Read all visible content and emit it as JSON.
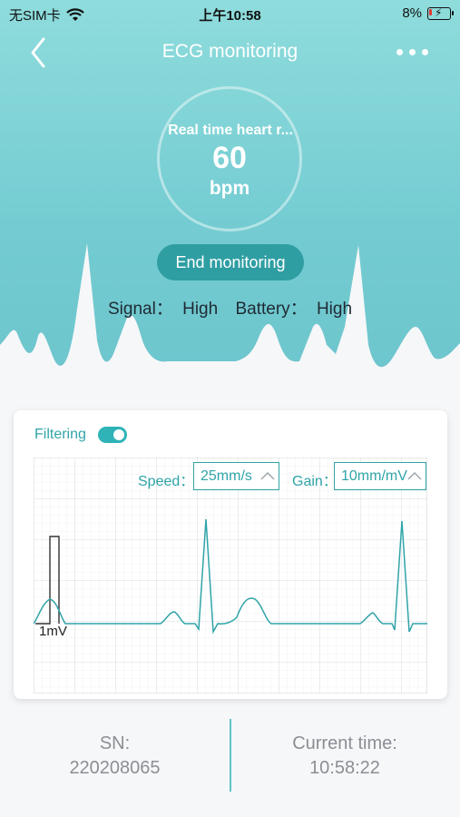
{
  "status_bar": {
    "carrier": "无SIM卡",
    "time": "上午10:58",
    "battery_percent": "8%"
  },
  "nav": {
    "title": "ECG monitoring"
  },
  "heart_rate": {
    "label": "Real time heart r...",
    "value": "60",
    "unit": "bpm"
  },
  "end_button": {
    "label": "End monitoring"
  },
  "device_status": {
    "signal_label": "Signal：",
    "signal_value": "High",
    "battery_label": "Battery：",
    "battery_value": "High"
  },
  "ecg_card": {
    "filtering_label": "Filtering",
    "filtering_on": true,
    "speed_label": "Speed：",
    "speed_value": "25mm/s",
    "gain_label": "Gain：",
    "gain_value": "10mm/mV",
    "calibration_label": "1mV"
  },
  "info": {
    "sn_label": "SN:",
    "sn_value": "220208065",
    "time_label": "Current time:",
    "time_value": "10:58:22"
  },
  "colors": {
    "accent": "#2fa4a8",
    "header_bg": "#74ccd2",
    "button_bg": "#2f9ea3",
    "divider": "#5ec3c8"
  }
}
